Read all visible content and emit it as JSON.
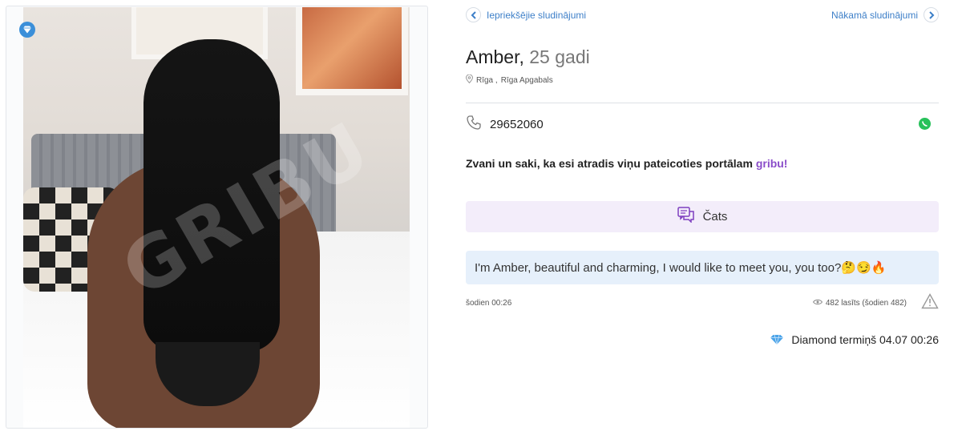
{
  "gallery": {
    "watermark": "GRIBU",
    "next_icon": "chevron-right-icon",
    "badge_icon": "diamond-icon"
  },
  "nav": {
    "prev_label": "Iepriekšējie sludinājumi",
    "next_label": "Nākamā sludinājumi"
  },
  "profile": {
    "name": "Amber,",
    "age": "25 gadi",
    "city": "Rīga ,",
    "region": "Rīga Apgabals"
  },
  "contact": {
    "phone": "29652060",
    "call_text": "Zvani un saki, ka esi atradis viņu pateicoties portālam",
    "brand": "gribu!"
  },
  "chat": {
    "label": "Čats"
  },
  "description": "I'm Amber, beautiful and charming, I would like to meet you, you too?🤔😏🔥",
  "meta": {
    "date": "šodien 00:26",
    "views": "482 lasīts (šodien 482)"
  },
  "diamond": {
    "label": "Diamond termiņš 04.07 00:26"
  },
  "colors": {
    "accent": "#3d7fc8",
    "brand": "#8a4cc9",
    "chat_bg": "#f3edfa",
    "desc_bg": "#e6f0fb",
    "whatsapp": "#27c15a"
  }
}
